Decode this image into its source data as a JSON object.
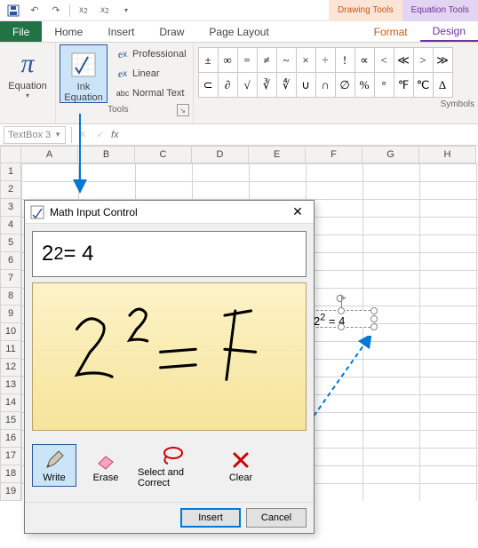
{
  "qat": {
    "save": "save",
    "undo": "undo",
    "redo": "redo"
  },
  "contextual": {
    "drawing": "Drawing Tools",
    "equation": "Equation Tools"
  },
  "tabs": {
    "file": "File",
    "home": "Home",
    "insert": "Insert",
    "draw": "Draw",
    "pagelayout": "Page Layout",
    "format": "Format",
    "design": "Design"
  },
  "ribbon": {
    "equation_label": "Equation",
    "ink_equation_label": "Ink\nEquation",
    "professional": "Professional",
    "linear": "Linear",
    "normal_text": "Normal Text",
    "tools_label": "Tools",
    "symbols_label": "Symbols",
    "symbols_row1": [
      "±",
      "∞",
      "=",
      "≠",
      "~",
      "×",
      "÷",
      "!",
      "∝",
      "<",
      "≪",
      ">",
      "≫"
    ],
    "symbols_row2": [
      "⊂",
      "∂",
      "√",
      "∛",
      "∜",
      "∪",
      "∩",
      "∅",
      "%",
      "°",
      "℉",
      "℃",
      "∆"
    ]
  },
  "namebox": "TextBox 3",
  "fx": "fx",
  "columns": [
    "A",
    "B",
    "C",
    "D",
    "E",
    "F",
    "G",
    "H"
  ],
  "rows": [
    "1",
    "2",
    "3",
    "4",
    "5",
    "6",
    "7",
    "8",
    "9",
    "10",
    "11",
    "12",
    "13",
    "14",
    "15",
    "16",
    "17",
    "18",
    "19"
  ],
  "shape_content": "2² = 4",
  "dialog": {
    "title": "Math Input Control",
    "preview_base": "2",
    "preview_exp": "2",
    "preview_rest": " = 4",
    "write": "Write",
    "erase": "Erase",
    "select_correct": "Select and Correct",
    "clear": "Clear",
    "insert": "Insert",
    "cancel": "Cancel"
  }
}
